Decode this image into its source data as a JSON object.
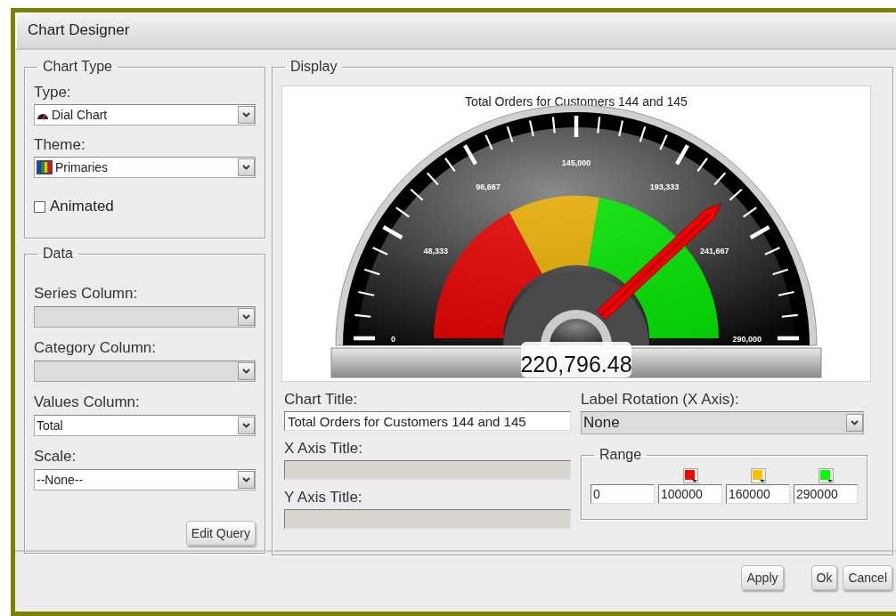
{
  "window": {
    "title": "Chart Designer"
  },
  "chart_type": {
    "legend": "Chart Type",
    "fields": [
      {
        "label": "Type:",
        "value": "Dial Chart",
        "kind": "type",
        "disabled": false
      },
      {
        "label": "Theme:",
        "value": "Primaries",
        "kind": "theme",
        "disabled": false
      }
    ],
    "animated": {
      "label": "Animated",
      "checked": false
    }
  },
  "data": {
    "legend": "Data",
    "fields": [
      {
        "label": "Series Column:",
        "disabled": true
      },
      {
        "label": "Category Column:",
        "disabled": true
      },
      {
        "label": "Values Column:",
        "value": "Total",
        "disabled": false
      },
      {
        "label": "Scale:",
        "value": "--None--",
        "disabled": false
      }
    ],
    "button": "Edit Query"
  },
  "display": {
    "legend": "Display",
    "gauge": {
      "title": "Total Orders for Customers 144 and 145",
      "reading": "220,796.48",
      "tick_labels": [
        "0",
        "48,333",
        "96,667",
        "145,000",
        "193,333",
        "241,667",
        "290,000"
      ]
    },
    "chart_title": {
      "label": "Chart Title:",
      "value": "Total Orders for Customers 144 and 145",
      "disabled": false
    },
    "x_axis_title": {
      "label": "X Axis Title:",
      "disabled": true
    },
    "y_axis_title": {
      "label": "Y Axis Title:",
      "disabled": true
    },
    "label_rotation": {
      "label": "Label Rotation (X Axis):",
      "value": "None"
    },
    "range": {
      "legend": "Range",
      "values": [
        "0",
        "100000",
        "160000",
        "290000"
      ],
      "bands": [
        {
          "color": "#ff0000"
        },
        {
          "color": "#ffc000"
        },
        {
          "color": "#00ff00"
        }
      ]
    }
  },
  "buttons": [
    "Apply",
    "Ok",
    "Cancel"
  ]
}
